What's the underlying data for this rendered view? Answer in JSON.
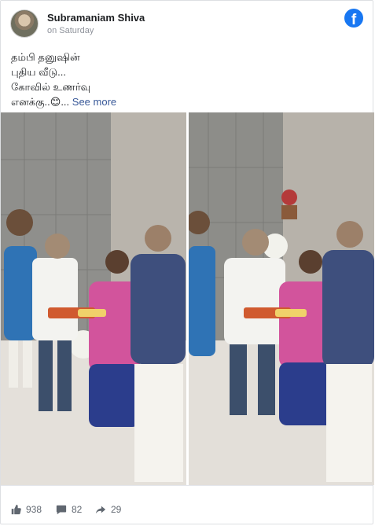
{
  "post": {
    "author": "Subramaniam Shiva",
    "timestamp": "on Saturday",
    "text_lines": [
      "தம்பி தனுஷின்",
      "புதிய வீடு...",
      "கோவில் உணர்வு",
      "எனக்கு..😊..."
    ],
    "see_more": "See more",
    "platform_icon": "facebook-icon"
  },
  "reactions": {
    "likes": "938",
    "comments": "82",
    "shares": "29"
  },
  "colors": {
    "brand": "#1877f2",
    "link": "#385898",
    "meta": "#90949c"
  }
}
